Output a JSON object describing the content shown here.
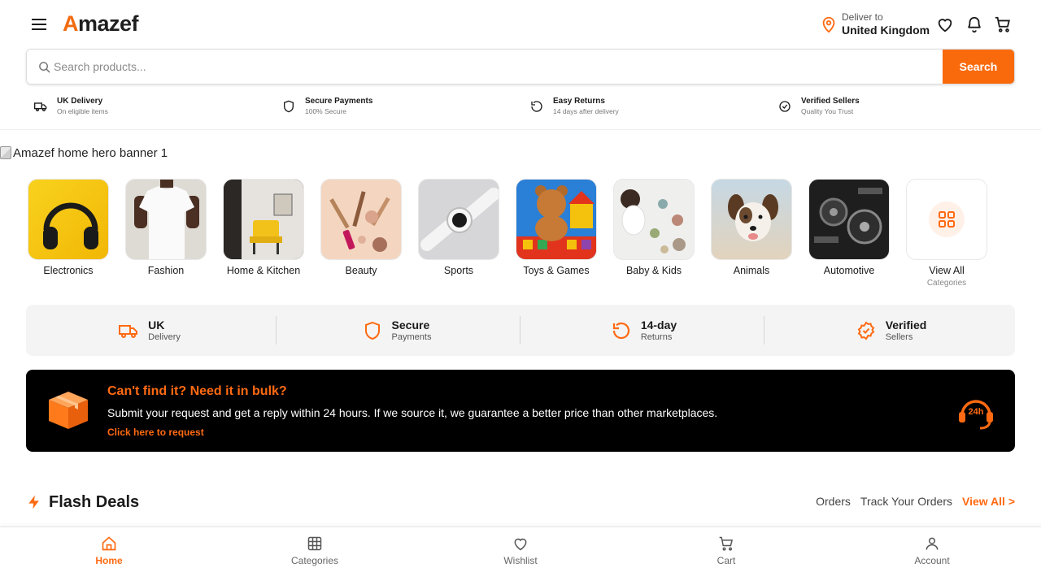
{
  "colors": {
    "accent": "#ff6a12",
    "search_button": "#f96a0d",
    "promo_bg": "#000000",
    "features_bg": "#f4f4f4"
  },
  "header": {
    "logo_first": "A",
    "logo_rest": "mazef",
    "deliver_label": "Deliver to",
    "deliver_country": "United Kingdom",
    "icons": [
      "menu-icon",
      "location-pin-icon",
      "heart-icon",
      "bell-icon",
      "cart-icon"
    ]
  },
  "search": {
    "placeholder": "Search products...",
    "button_label": "Search"
  },
  "trust": [
    {
      "title": "UK Delivery",
      "subtitle": "On eligible items",
      "icon": "truck-icon"
    },
    {
      "title": "Secure Payments",
      "subtitle": "100% Secure",
      "icon": "shield-icon"
    },
    {
      "title": "Easy Returns",
      "subtitle": "14 days after delivery",
      "icon": "return-icon"
    },
    {
      "title": "Verified Sellers",
      "subtitle": "Quality You Trust",
      "icon": "verified-badge-icon"
    }
  ],
  "hero": {
    "alt_text": "Amazef home hero banner 1"
  },
  "categories": [
    {
      "label": "Electronics"
    },
    {
      "label": "Fashion"
    },
    {
      "label": "Home & Kitchen"
    },
    {
      "label": "Beauty"
    },
    {
      "label": "Sports"
    },
    {
      "label": "Toys & Games"
    },
    {
      "label": "Baby & Kids"
    },
    {
      "label": "Animals"
    },
    {
      "label": "Automotive"
    }
  ],
  "view_all": {
    "label": "View All",
    "sublabel": "Categories"
  },
  "features": [
    {
      "title": "UK",
      "subtitle": "Delivery"
    },
    {
      "title": "Secure",
      "subtitle": "Payments"
    },
    {
      "title": "14-day",
      "subtitle": "Returns"
    },
    {
      "title": "Verified",
      "subtitle": "Sellers"
    }
  ],
  "promo": {
    "title": "Can't find it? Need it in bulk?",
    "description": "Submit your request and get a reply within 24 hours. If we source it, we guarantee a better price than other marketplaces.",
    "link": "Click here to request",
    "badge": "24h"
  },
  "flash": {
    "title": "Flash Deals",
    "links": [
      "Orders",
      "Track Your Orders"
    ],
    "view_all": "View All >"
  },
  "bottom_nav": [
    {
      "label": "Home",
      "icon": "home-icon",
      "active": true
    },
    {
      "label": "Categories",
      "icon": "grid-icon",
      "active": false
    },
    {
      "label": "Wishlist",
      "icon": "heart-icon",
      "active": false
    },
    {
      "label": "Cart",
      "icon": "cart-icon",
      "active": false
    },
    {
      "label": "Account",
      "icon": "user-icon",
      "active": false
    }
  ]
}
